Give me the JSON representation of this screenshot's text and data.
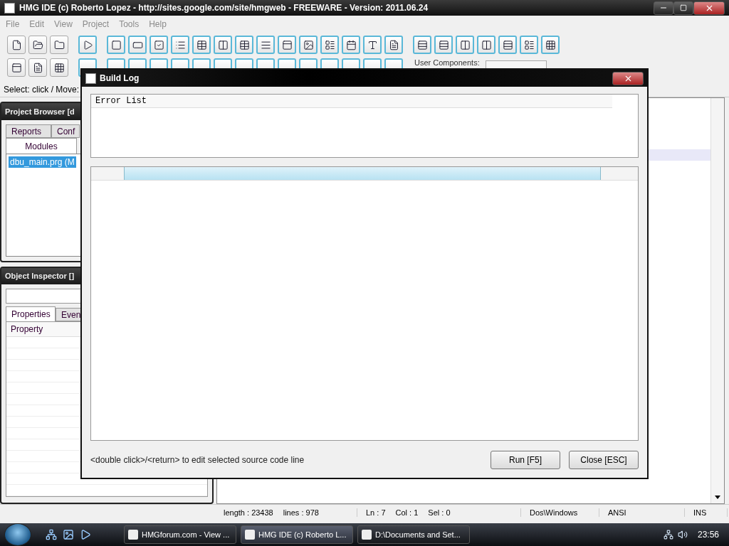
{
  "window": {
    "title": "HMG IDE (c) Roberto Lopez - http://sites.google.com/site/hmgweb - FREEWARE - Version: 2011.06.24"
  },
  "menu": [
    {
      "label": "File",
      "disabled": true
    },
    {
      "label": "Edit",
      "disabled": true
    },
    {
      "label": "View",
      "disabled": true
    },
    {
      "label": "Project",
      "disabled": true
    },
    {
      "label": "Tools",
      "disabled": true
    },
    {
      "label": "Help",
      "disabled": true
    }
  ],
  "toolbar": {
    "user_components_label": "User Components:"
  },
  "select_hint": "Select: click / Move:",
  "project_browser": {
    "title": "Project Browser [d",
    "tabs": [
      {
        "label": "Reports",
        "selected": false
      },
      {
        "label": "Conf",
        "selected": false
      },
      {
        "label": "Modules",
        "selected": true
      }
    ],
    "items": [
      {
        "label": "dbu_main.prg (M",
        "selected": true
      }
    ]
  },
  "object_inspector": {
    "title": "Object Inspector []",
    "tabs": [
      {
        "label": "Properties",
        "selected": true
      },
      {
        "label": "Even",
        "selected": false
      }
    ],
    "columns": [
      "Property"
    ]
  },
  "status_bar": [
    "length : 23438",
    "lines : 978",
    "Ln : 7",
    "Col : 1",
    "Sel : 0",
    "Dos\\Windows",
    "ANSI",
    "INS"
  ],
  "dialog": {
    "title": "Build Log",
    "error_list_header": "Error List",
    "hint": "<double click>/<return> to edit selected source code line",
    "buttons": [
      "Run [F5]",
      "Close [ESC]"
    ]
  },
  "taskbar": {
    "tasks": [
      {
        "label": "HMGforum.com - View ...",
        "selected": false
      },
      {
        "label": "HMG IDE (c) Roberto L...",
        "selected": true
      },
      {
        "label": "D:\\Documents and Set...",
        "selected": false
      }
    ],
    "clock": "23:56"
  }
}
